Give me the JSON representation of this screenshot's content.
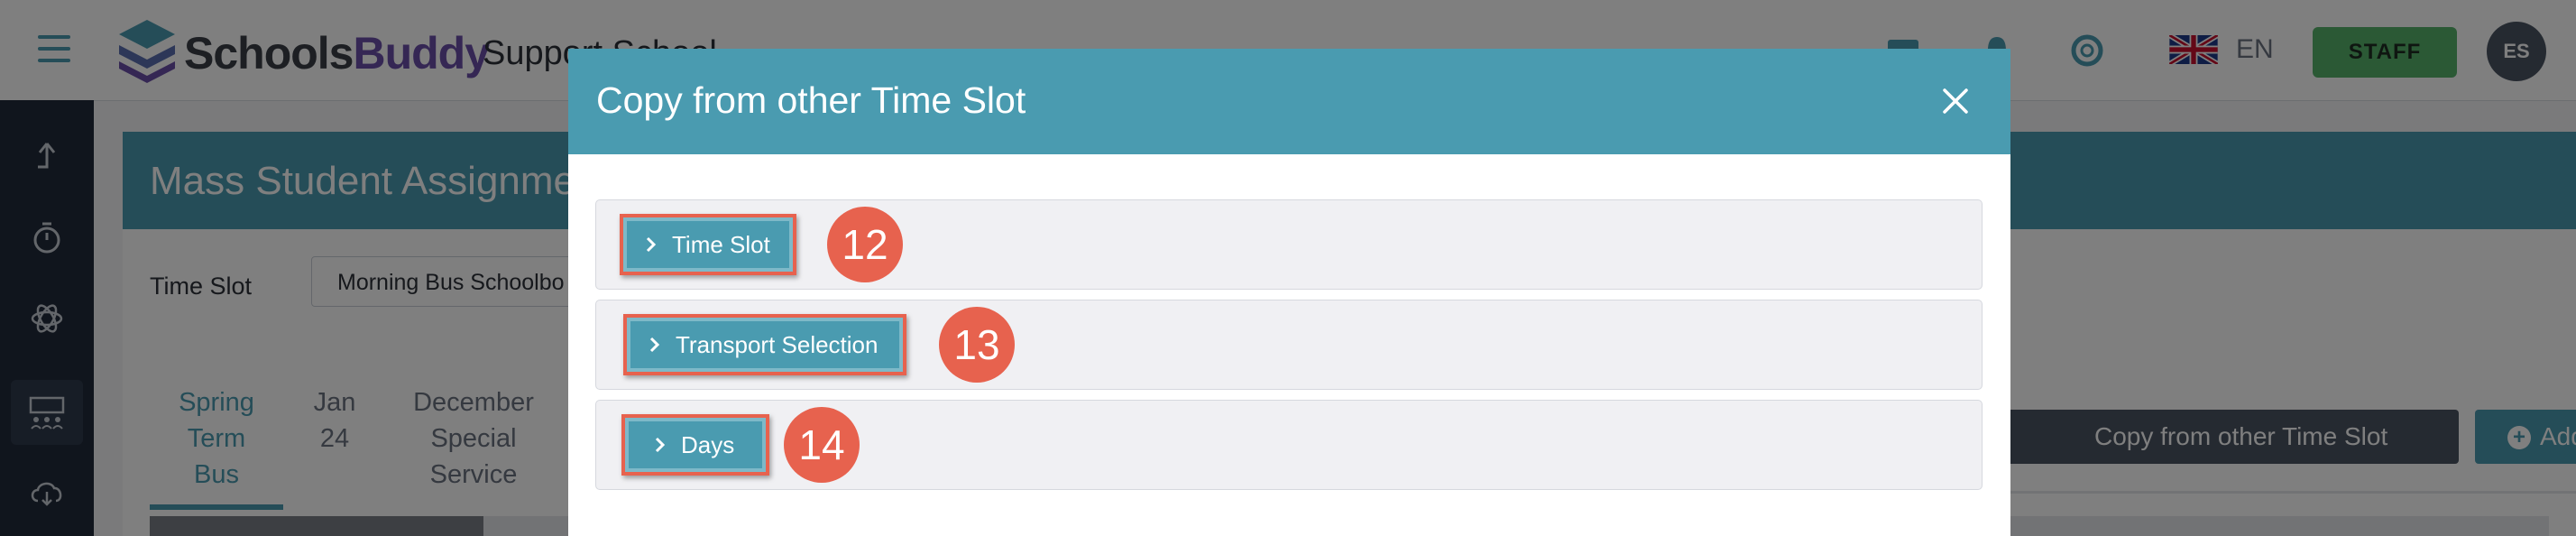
{
  "header": {
    "logo_part1": "Schools",
    "logo_part2": "Buddy",
    "school_name": "Support School",
    "language": "EN",
    "staff_label": "STAFF",
    "avatar_initials": "ES"
  },
  "page": {
    "title": "Mass Student Assignment",
    "time_slot_label": "Time Slot",
    "time_slot_value": "Morning Bus Schoolbo",
    "tabs": [
      {
        "label": "Spring Term Bus",
        "active": true
      },
      {
        "label": "Jan 24",
        "active": false
      },
      {
        "label": "December Special Service",
        "active": false
      }
    ],
    "copy_button": "Copy from other Time Slot",
    "add_button": "Add"
  },
  "modal": {
    "title": "Copy from other Time Slot",
    "sections": [
      {
        "label": "Time Slot",
        "badge": "12"
      },
      {
        "label": "Transport Selection",
        "badge": "13"
      },
      {
        "label": "Days",
        "badge": "14"
      }
    ]
  },
  "icons": {
    "menu": "hamburger-icon",
    "upload": "upload-icon",
    "timer": "stopwatch-icon",
    "activities": "atom-icon",
    "classroom": "classroom-icon",
    "cloud": "cloud-download-icon",
    "close": "close-icon",
    "chevron": "chevron-right-icon"
  },
  "colors": {
    "accent": "#4a9bb0",
    "badge": "#e7624e",
    "staff": "#57b36a",
    "sidebar": "#212a3a"
  }
}
